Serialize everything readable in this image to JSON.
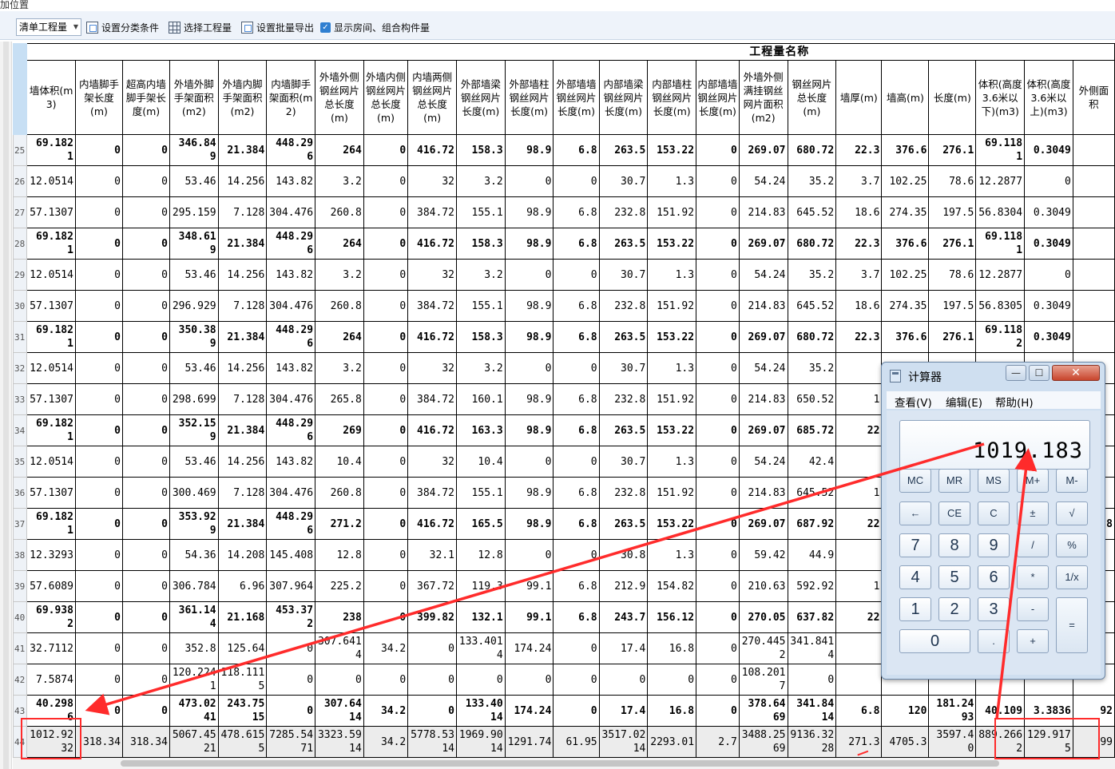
{
  "top": {
    "label": "加位置"
  },
  "toolbar": {
    "select_value": "清单工程量",
    "btn_category": "设置分类条件",
    "btn_select": "选择工程量",
    "btn_batch_export": "设置批量导出",
    "checkbox_label": "显示房间、组合构件量",
    "checkbox_checked": true
  },
  "table": {
    "super_header": "工程量名称",
    "columns": [
      "墙体积(m3)",
      "内墙脚手架长度(m)",
      "超高内墙脚手架长度(m)",
      "外墙外脚手架面积(m2)",
      "外墙内脚手架面积(m2)",
      "内墙脚手架面积(m2)",
      "外墙外侧钢丝网片总长度(m)",
      "外墙内侧钢丝网片总长度(m)",
      "内墙两侧钢丝网片总长度(m)",
      "外部墙梁钢丝网片长度(m)",
      "外部墙柱钢丝网片长度(m)",
      "外部墙墙钢丝网片长度(m)",
      "内部墙梁钢丝网片长度(m)",
      "内部墙柱钢丝网片长度(m)",
      "内部墙墙钢丝网片长度(m)",
      "外墙外侧满挂钢丝网片面积(m2)",
      "钢丝网片总长度(m)",
      "墙厚(m)",
      "墙高(m)",
      "长度(m)",
      "体积(高度3.6米以下)(m3)",
      "体积(高度3.6米以上)(m3)",
      "外侧面积"
    ],
    "rows": [
      {
        "n": "25",
        "bold": true,
        "cells": [
          "69.182\n1",
          "0",
          "0",
          "346.84\n9",
          "21.384",
          "448.29\n6",
          "264",
          "0",
          "416.72",
          "158.3",
          "98.9",
          "6.8",
          "263.5",
          "153.22",
          "0",
          "269.07",
          "680.72",
          "22.3",
          "376.6",
          "276.1",
          "69.118\n1",
          "0.3049",
          ""
        ]
      },
      {
        "n": "26",
        "bold": false,
        "cells": [
          "12.0514",
          "0",
          "0",
          "53.46",
          "14.256",
          "143.82",
          "3.2",
          "0",
          "32",
          "3.2",
          "0",
          "0",
          "30.7",
          "1.3",
          "0",
          "54.24",
          "35.2",
          "3.7",
          "102.25",
          "78.6",
          "12.2877",
          "0",
          ""
        ]
      },
      {
        "n": "27",
        "bold": false,
        "cells": [
          "57.1307",
          "0",
          "0",
          "295.159",
          "7.128",
          "304.476",
          "260.8",
          "0",
          "384.72",
          "155.1",
          "98.9",
          "6.8",
          "232.8",
          "151.92",
          "0",
          "214.83",
          "645.52",
          "18.6",
          "274.35",
          "197.5",
          "56.8304",
          "0.3049",
          ""
        ]
      },
      {
        "n": "28",
        "bold": true,
        "cells": [
          "69.182\n1",
          "0",
          "0",
          "348.61\n9",
          "21.384",
          "448.29\n6",
          "264",
          "0",
          "416.72",
          "158.3",
          "98.9",
          "6.8",
          "263.5",
          "153.22",
          "0",
          "269.07",
          "680.72",
          "22.3",
          "376.6",
          "276.1",
          "69.118\n1",
          "0.3049",
          ""
        ]
      },
      {
        "n": "29",
        "bold": false,
        "cells": [
          "12.0514",
          "0",
          "0",
          "53.46",
          "14.256",
          "143.82",
          "3.2",
          "0",
          "32",
          "3.2",
          "0",
          "0",
          "30.7",
          "1.3",
          "0",
          "54.24",
          "35.2",
          "3.7",
          "102.25",
          "78.6",
          "12.2877",
          "0",
          ""
        ]
      },
      {
        "n": "30",
        "bold": false,
        "cells": [
          "57.1307",
          "0",
          "0",
          "296.929",
          "7.128",
          "304.476",
          "260.8",
          "0",
          "384.72",
          "155.1",
          "98.9",
          "6.8",
          "232.8",
          "151.92",
          "0",
          "214.83",
          "645.52",
          "18.6",
          "274.35",
          "197.5",
          "56.8305",
          "0.3049",
          ""
        ]
      },
      {
        "n": "31",
        "bold": true,
        "cells": [
          "69.182\n1",
          "0",
          "0",
          "350.38\n9",
          "21.384",
          "448.29\n6",
          "264",
          "0",
          "416.72",
          "158.3",
          "98.9",
          "6.8",
          "263.5",
          "153.22",
          "0",
          "269.07",
          "680.72",
          "22.3",
          "376.6",
          "276.1",
          "69.118\n2",
          "0.3049",
          ""
        ]
      },
      {
        "n": "32",
        "bold": false,
        "cells": [
          "12.0514",
          "0",
          "0",
          "53.46",
          "14.256",
          "143.82",
          "3.2",
          "0",
          "32",
          "3.2",
          "0",
          "0",
          "30.7",
          "1.3",
          "0",
          "54.24",
          "35.2",
          "",
          "",
          "",
          "",
          "",
          ""
        ]
      },
      {
        "n": "33",
        "bold": false,
        "cells": [
          "57.1307",
          "0",
          "0",
          "298.699",
          "7.128",
          "304.476",
          "265.8",
          "0",
          "384.72",
          "160.1",
          "98.9",
          "6.8",
          "232.8",
          "151.92",
          "0",
          "214.83",
          "650.52",
          "1",
          "",
          "",
          "",
          "",
          ""
        ]
      },
      {
        "n": "34",
        "bold": true,
        "cells": [
          "69.182\n1",
          "0",
          "0",
          "352.15\n9",
          "21.384",
          "448.29\n6",
          "269",
          "0",
          "416.72",
          "163.3",
          "98.9",
          "6.8",
          "263.5",
          "153.22",
          "0",
          "269.07",
          "685.72",
          "22",
          "",
          "",
          "",
          "",
          ""
        ]
      },
      {
        "n": "35",
        "bold": false,
        "cells": [
          "12.0514",
          "0",
          "0",
          "53.46",
          "14.256",
          "143.82",
          "10.4",
          "0",
          "32",
          "10.4",
          "0",
          "0",
          "30.7",
          "1.3",
          "0",
          "54.24",
          "42.4",
          "",
          "",
          "",
          "",
          "",
          ""
        ]
      },
      {
        "n": "36",
        "bold": false,
        "cells": [
          "57.1307",
          "0",
          "0",
          "300.469",
          "7.128",
          "304.476",
          "260.8",
          "0",
          "384.72",
          "155.1",
          "98.9",
          "6.8",
          "232.8",
          "151.92",
          "0",
          "214.83",
          "645.52",
          "1",
          "",
          "",
          "",
          "",
          ""
        ]
      },
      {
        "n": "37",
        "bold": true,
        "cells": [
          "69.182\n1",
          "0",
          "0",
          "353.92\n9",
          "21.384",
          "448.29\n6",
          "271.2",
          "0",
          "416.72",
          "165.5",
          "98.9",
          "6.8",
          "263.5",
          "153.22",
          "0",
          "269.07",
          "687.92",
          "22",
          "",
          "",
          "",
          "",
          "8"
        ]
      },
      {
        "n": "38",
        "bold": false,
        "cells": [
          "12.3293",
          "0",
          "0",
          "54.36",
          "14.208",
          "145.408",
          "12.8",
          "0",
          "32.1",
          "12.8",
          "0",
          "0",
          "30.8",
          "1.3",
          "0",
          "59.42",
          "44.9",
          "",
          "",
          "",
          "",
          "",
          ""
        ]
      },
      {
        "n": "39",
        "bold": false,
        "cells": [
          "57.6089",
          "0",
          "0",
          "306.784",
          "6.96",
          "307.964",
          "225.2",
          "0",
          "367.72",
          "119.3",
          "99.1",
          "6.8",
          "212.9",
          "154.82",
          "0",
          "210.63",
          "592.92",
          "1",
          "",
          "",
          "",
          "",
          ""
        ]
      },
      {
        "n": "40",
        "bold": true,
        "cells": [
          "69.938\n2",
          "0",
          "0",
          "361.14\n4",
          "21.168",
          "453.37\n2",
          "238",
          "0",
          "399.82",
          "132.1",
          "99.1",
          "6.8",
          "243.7",
          "156.12",
          "0",
          "270.05",
          "637.82",
          "22",
          "",
          "",
          "",
          "",
          ""
        ]
      },
      {
        "n": "41",
        "bold": false,
        "cells": [
          "32.7112",
          "0",
          "0",
          "352.8",
          "125.64",
          "0",
          "307.641\n4",
          "34.2",
          "0",
          "133.401\n4",
          "174.24",
          "0",
          "17.4",
          "16.8",
          "0",
          "270.445\n2",
          "341.841\n4",
          "",
          "",
          "",
          "",
          "",
          ""
        ]
      },
      {
        "n": "42",
        "bold": false,
        "cells": [
          "7.5874",
          "0",
          "0",
          "120.224\n1",
          "118.111\n5",
          "0",
          "0",
          "0",
          "0",
          "0",
          "0",
          "0",
          "0",
          "0",
          "0",
          "108.201\n7",
          "0",
          "",
          "",
          "",
          "",
          "",
          ""
        ]
      },
      {
        "n": "43",
        "bold": true,
        "cells": [
          "40.298\n6",
          "0",
          "0",
          "473.02\n41",
          "243.75\n15",
          "0",
          "307.64\n14",
          "34.2",
          "0",
          "133.40\n14",
          "174.24",
          "0",
          "17.4",
          "16.8",
          "0",
          "378.64\n69",
          "341.84\n14",
          "6.8",
          "120",
          "181.24\n93",
          "40.109",
          "3.3836",
          "92"
        ]
      },
      {
        "n": "44",
        "bold": false,
        "total": true,
        "cells": [
          "1012.92\n32",
          "318.34",
          "318.34",
          "5067.45\n21",
          "478.615\n5",
          "7285.54\n71",
          "3323.59\n14",
          "34.2",
          "5778.53\n14",
          "1969.90\n14",
          "1291.74",
          "61.95",
          "3517.02\n14",
          "2293.01",
          "2.7",
          "3488.25\n69",
          "9136.32\n28",
          "271.3",
          "4705.3",
          "3597.4\n0",
          "889.266\n2",
          "129.917\n5",
          "99"
        ]
      }
    ]
  },
  "calculator": {
    "title": "计算器",
    "menu": {
      "view": "查看(V)",
      "edit": "编辑(E)",
      "help": "帮助(H)"
    },
    "display": "1019.183",
    "buttons": {
      "mc": "MC",
      "mr": "MR",
      "ms": "MS",
      "mplus": "M+",
      "mminus": "M-",
      "back": "←",
      "ce": "CE",
      "c": "C",
      "pm": "±",
      "sqrt": "√",
      "n7": "7",
      "n8": "8",
      "n9": "9",
      "div": "/",
      "pct": "%",
      "n4": "4",
      "n5": "5",
      "n6": "6",
      "mul": "*",
      "inv": "1/x",
      "n1": "1",
      "n2": "2",
      "n3": "3",
      "sub": "-",
      "eq": "=",
      "n0": "0",
      "dot": ".",
      "add": "+"
    }
  },
  "annotations": {
    "color": "#ff2b2b"
  }
}
